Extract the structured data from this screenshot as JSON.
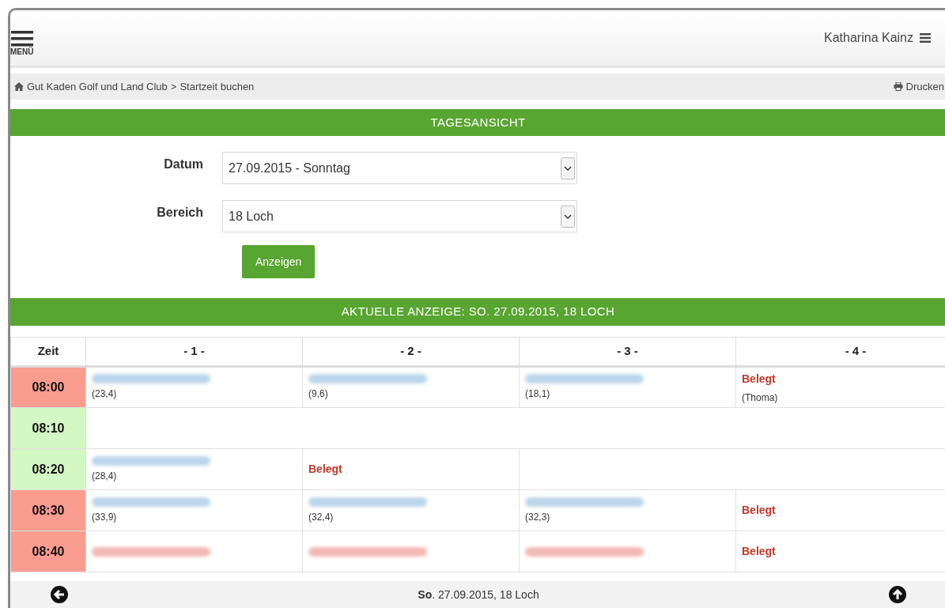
{
  "header": {
    "menu_label": "MENÜ",
    "user_name": "Katharina Kainz"
  },
  "breadcrumb": {
    "items": [
      "Gut Kaden Golf und Land Club",
      "Startzeit buchen"
    ],
    "separator": ">",
    "print_label": "Drucken"
  },
  "day_view": {
    "title": "TAGESANSICHT",
    "fields": [
      {
        "label": "Datum",
        "value": "27.09.2015 - Sonntag"
      },
      {
        "label": "Bereich",
        "value": "18 Loch"
      }
    ],
    "submit": "Anzeigen"
  },
  "current": {
    "title": "AKTUELLE ANZEIGE: SO. 27.09.2015, 18 LOCH"
  },
  "table": {
    "time_column": "Zeit",
    "columns": [
      "- 1 -",
      "- 2 -",
      "- 3 -",
      "- 4 -"
    ],
    "rows": [
      {
        "time": "08:00",
        "booked": true,
        "cells": [
          {
            "blurred_name": true,
            "color": "#bcd6ec",
            "detail": "(23,4)"
          },
          {
            "blurred_name": true,
            "color": "#bcd6ec",
            "detail": "(9,6)"
          },
          {
            "blurred_name": true,
            "color": "#bcd6ec",
            "detail": "(18,1)"
          },
          {
            "status": "Belegt",
            "detail": "(Thoma)"
          }
        ]
      },
      {
        "time": "08:10",
        "booked": false,
        "cells": [
          "",
          "",
          "",
          ""
        ]
      },
      {
        "time": "08:20",
        "booked": false,
        "cells": [
          {
            "blurred_name": true,
            "color": "#bcd6ec",
            "detail": "(28,4)"
          },
          {
            "status": "Belegt"
          },
          "",
          ""
        ]
      },
      {
        "time": "08:30",
        "booked": true,
        "cells": [
          {
            "blurred_name": true,
            "color": "#bcd6ec",
            "detail": "(33,9)"
          },
          {
            "blurred_name": true,
            "color": "#bcd6ec",
            "detail": "(32,4)"
          },
          {
            "blurred_name": true,
            "color": "#bcd6ec",
            "detail": "(32,3)"
          },
          {
            "status": "Belegt"
          }
        ]
      },
      {
        "time": "08:40",
        "booked": true,
        "cells": [
          {
            "blurred_name": true,
            "color": "#f2b8b4"
          },
          {
            "blurred_name": true,
            "color": "#f2b8b4"
          },
          {
            "blurred_name": true,
            "color": "#f2b8b4"
          },
          {
            "status": "Belegt"
          }
        ]
      }
    ]
  },
  "footer": {
    "summary": "**So**. 27.09.2015, 18 Loch"
  }
}
